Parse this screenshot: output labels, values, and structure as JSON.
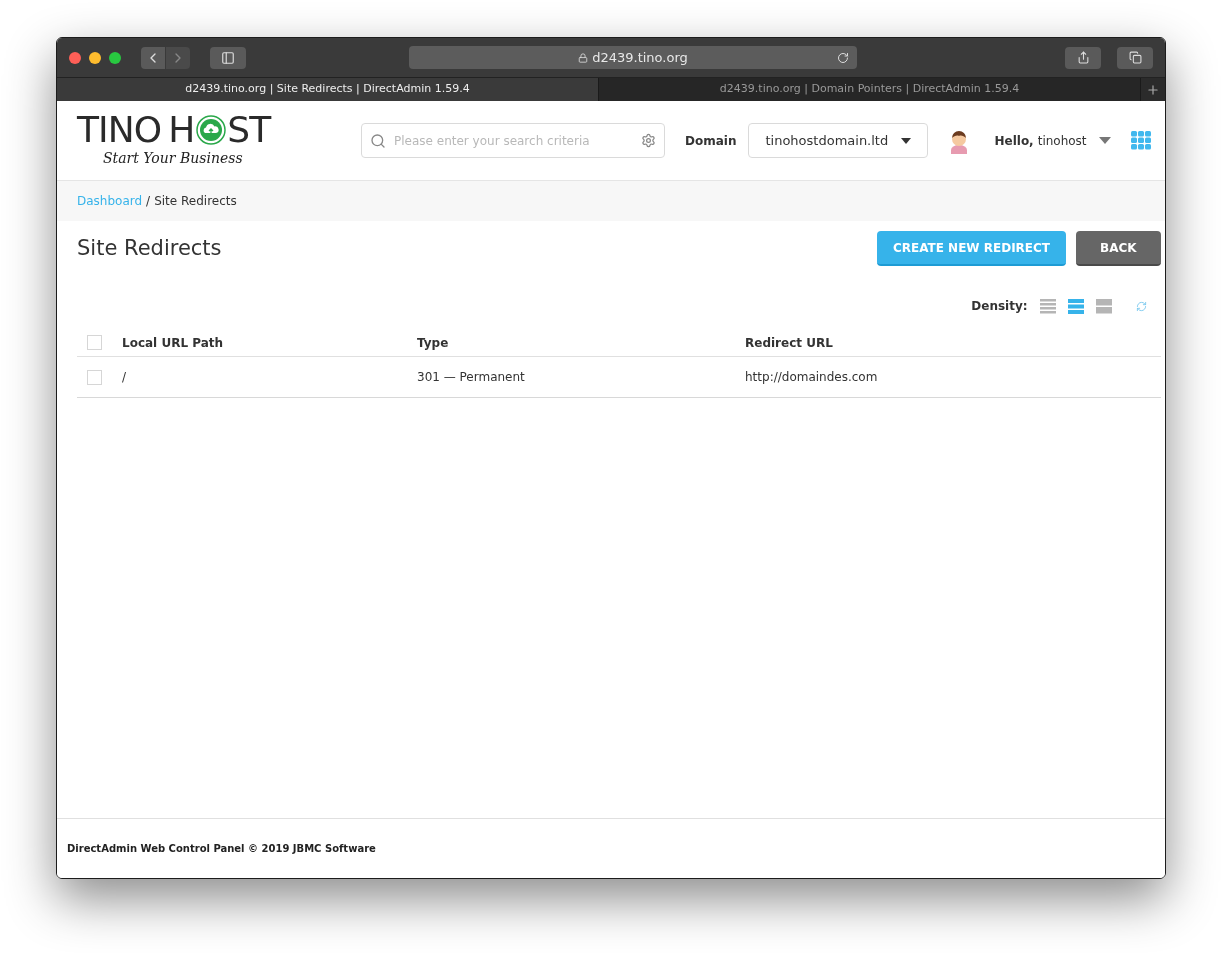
{
  "browser": {
    "address": "d2439.tino.org",
    "tabs": [
      {
        "label": "d2439.tino.org | Site Redirects | DirectAdmin 1.59.4",
        "selected": true
      },
      {
        "label": "d2439.tino.org | Domain Pointers | DirectAdmin 1.59.4",
        "selected": false
      }
    ]
  },
  "logo": {
    "word_start": "TINO",
    "word_mid": "H",
    "word_end": "ST",
    "tagline": "Start Your Business"
  },
  "search": {
    "placeholder": "Please enter your search criteria"
  },
  "domain": {
    "label": "Domain",
    "value": "tinohostdomain.ltd"
  },
  "user": {
    "greeting": "Hello,",
    "name": "tinohost"
  },
  "breadcrumb": {
    "link": "Dashboard",
    "separator": "/",
    "current": "Site Redirects"
  },
  "page_title": "Site Redirects",
  "buttons": [
    {
      "label": "CREATE NEW REDIRECT",
      "kind": "primary"
    },
    {
      "label": "BACK",
      "kind": "secondary"
    }
  ],
  "density": {
    "label": "Density:",
    "options": [
      {
        "kind": "compact",
        "selected": false
      },
      {
        "kind": "normal",
        "selected": true
      },
      {
        "kind": "comfortable",
        "selected": false
      }
    ]
  },
  "table": {
    "columns": [
      "Local URL Path",
      "Type",
      "Redirect URL"
    ],
    "all_checked": false,
    "rows": [
      {
        "checked": false,
        "cells": [
          "/",
          "301 — Permanent",
          "http://domaindes.com"
        ]
      }
    ]
  },
  "footer": "DirectAdmin Web Control Panel © 2019 JBMC Software"
}
